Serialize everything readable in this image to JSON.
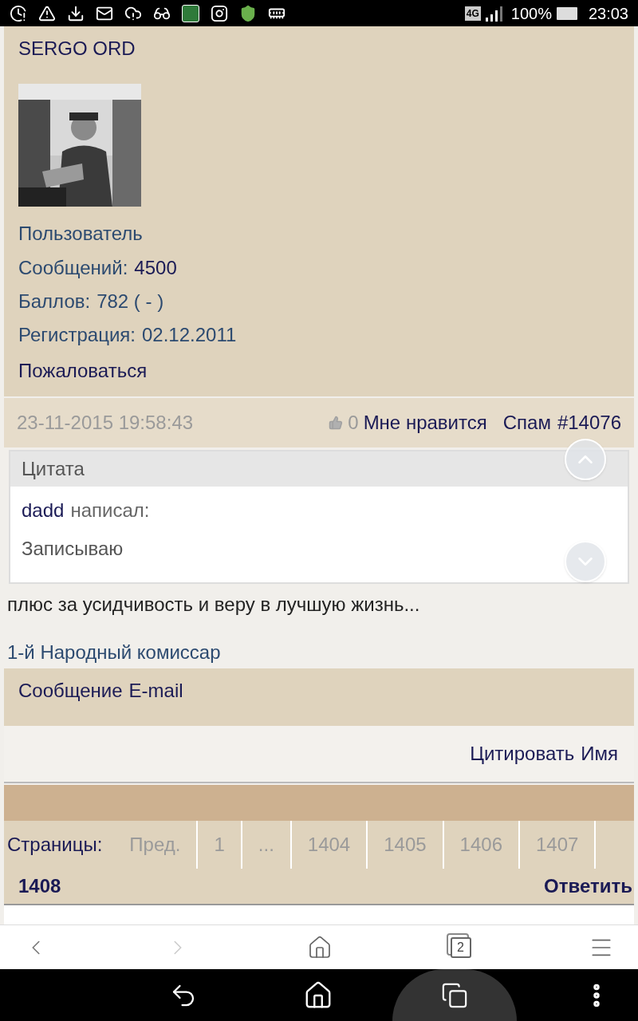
{
  "status_bar": {
    "network": "4G",
    "battery": "100%",
    "time": "23:03"
  },
  "profile": {
    "name": "SERGO ORD",
    "rank": "Пользователь",
    "stats": [
      {
        "label": "Сообщений:",
        "value": "4500",
        "emphasis": true
      },
      {
        "label": "Баллов:",
        "value": "782 ( - )",
        "emphasis": false
      },
      {
        "label": "Регистрация:",
        "value": "02.12.2011",
        "emphasis": false
      }
    ],
    "report": "Пожаловаться"
  },
  "post": {
    "date": "23-11-2015 19:58:43",
    "likes": "0",
    "like_label": "Мне нравится",
    "spam": "Спам",
    "number": "#14076",
    "quote": {
      "title": "Цитата",
      "author": "dadd",
      "wrote": "написал:",
      "text": "Записываю"
    },
    "body": "плюс за усидчивость и веру в лучшую жизнь...",
    "signature": "1-й Народный комиссар",
    "contact_links": [
      "Сообщение",
      "E-mail"
    ],
    "actions": [
      "Цитировать",
      "Имя"
    ]
  },
  "pagination": {
    "label": "Страницы:",
    "pages": [
      {
        "label": "Пред.",
        "selected": false
      },
      {
        "label": "1",
        "selected": false
      },
      {
        "label": "...",
        "selected": false
      },
      {
        "label": "1404",
        "selected": false
      },
      {
        "label": "1405",
        "selected": false
      },
      {
        "label": "1406",
        "selected": false
      },
      {
        "label": "1407",
        "selected": false
      },
      {
        "label": "1408",
        "selected": true
      }
    ],
    "reply": "Ответить"
  },
  "browser_toolbar": {
    "tab_count": "2",
    "forward_enabled": false
  }
}
